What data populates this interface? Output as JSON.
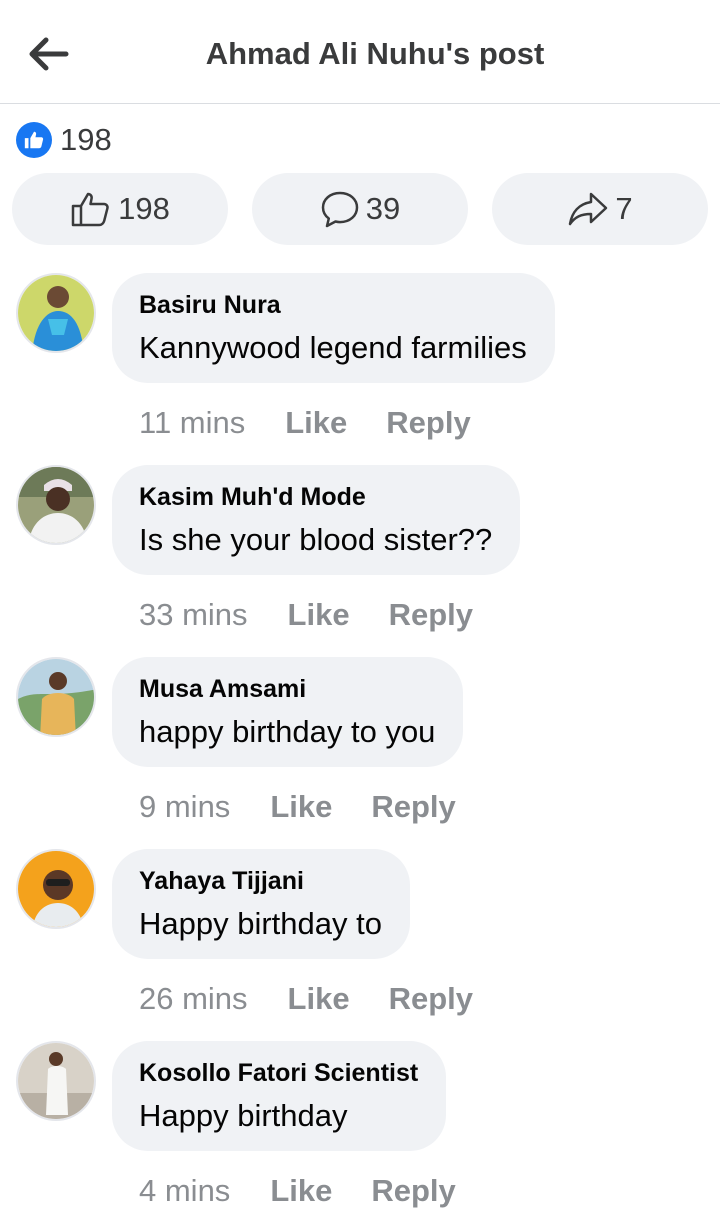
{
  "header": {
    "title": "Ahmad Ali Nuhu's post",
    "back_icon": "arrow-left-icon"
  },
  "reactions": {
    "count": "198",
    "icon": "like-badge-icon",
    "accent_color": "#1877f2"
  },
  "actions": {
    "like_count": "198",
    "comment_count": "39",
    "share_count": "7"
  },
  "comments": [
    {
      "author": "Basiru Nura",
      "text": "Kannywood legend farmilies",
      "time": "11 mins",
      "like_label": "Like",
      "reply_label": "Reply"
    },
    {
      "author": "Kasim Muh'd Mode",
      "text": "Is she your blood sister??",
      "time": "33 mins",
      "like_label": "Like",
      "reply_label": "Reply"
    },
    {
      "author": "Musa Amsami",
      "text": "happy birthday to you",
      "time": "9 mins",
      "like_label": "Like",
      "reply_label": "Reply"
    },
    {
      "author": "Yahaya Tijjani",
      "text": "Happy birthday to",
      "time": "26 mins",
      "like_label": "Like",
      "reply_label": "Reply"
    },
    {
      "author": "Kosollo Fatori Scientist",
      "text": "Happy birthday",
      "time": "4 mins",
      "like_label": "Like",
      "reply_label": "Reply"
    }
  ]
}
